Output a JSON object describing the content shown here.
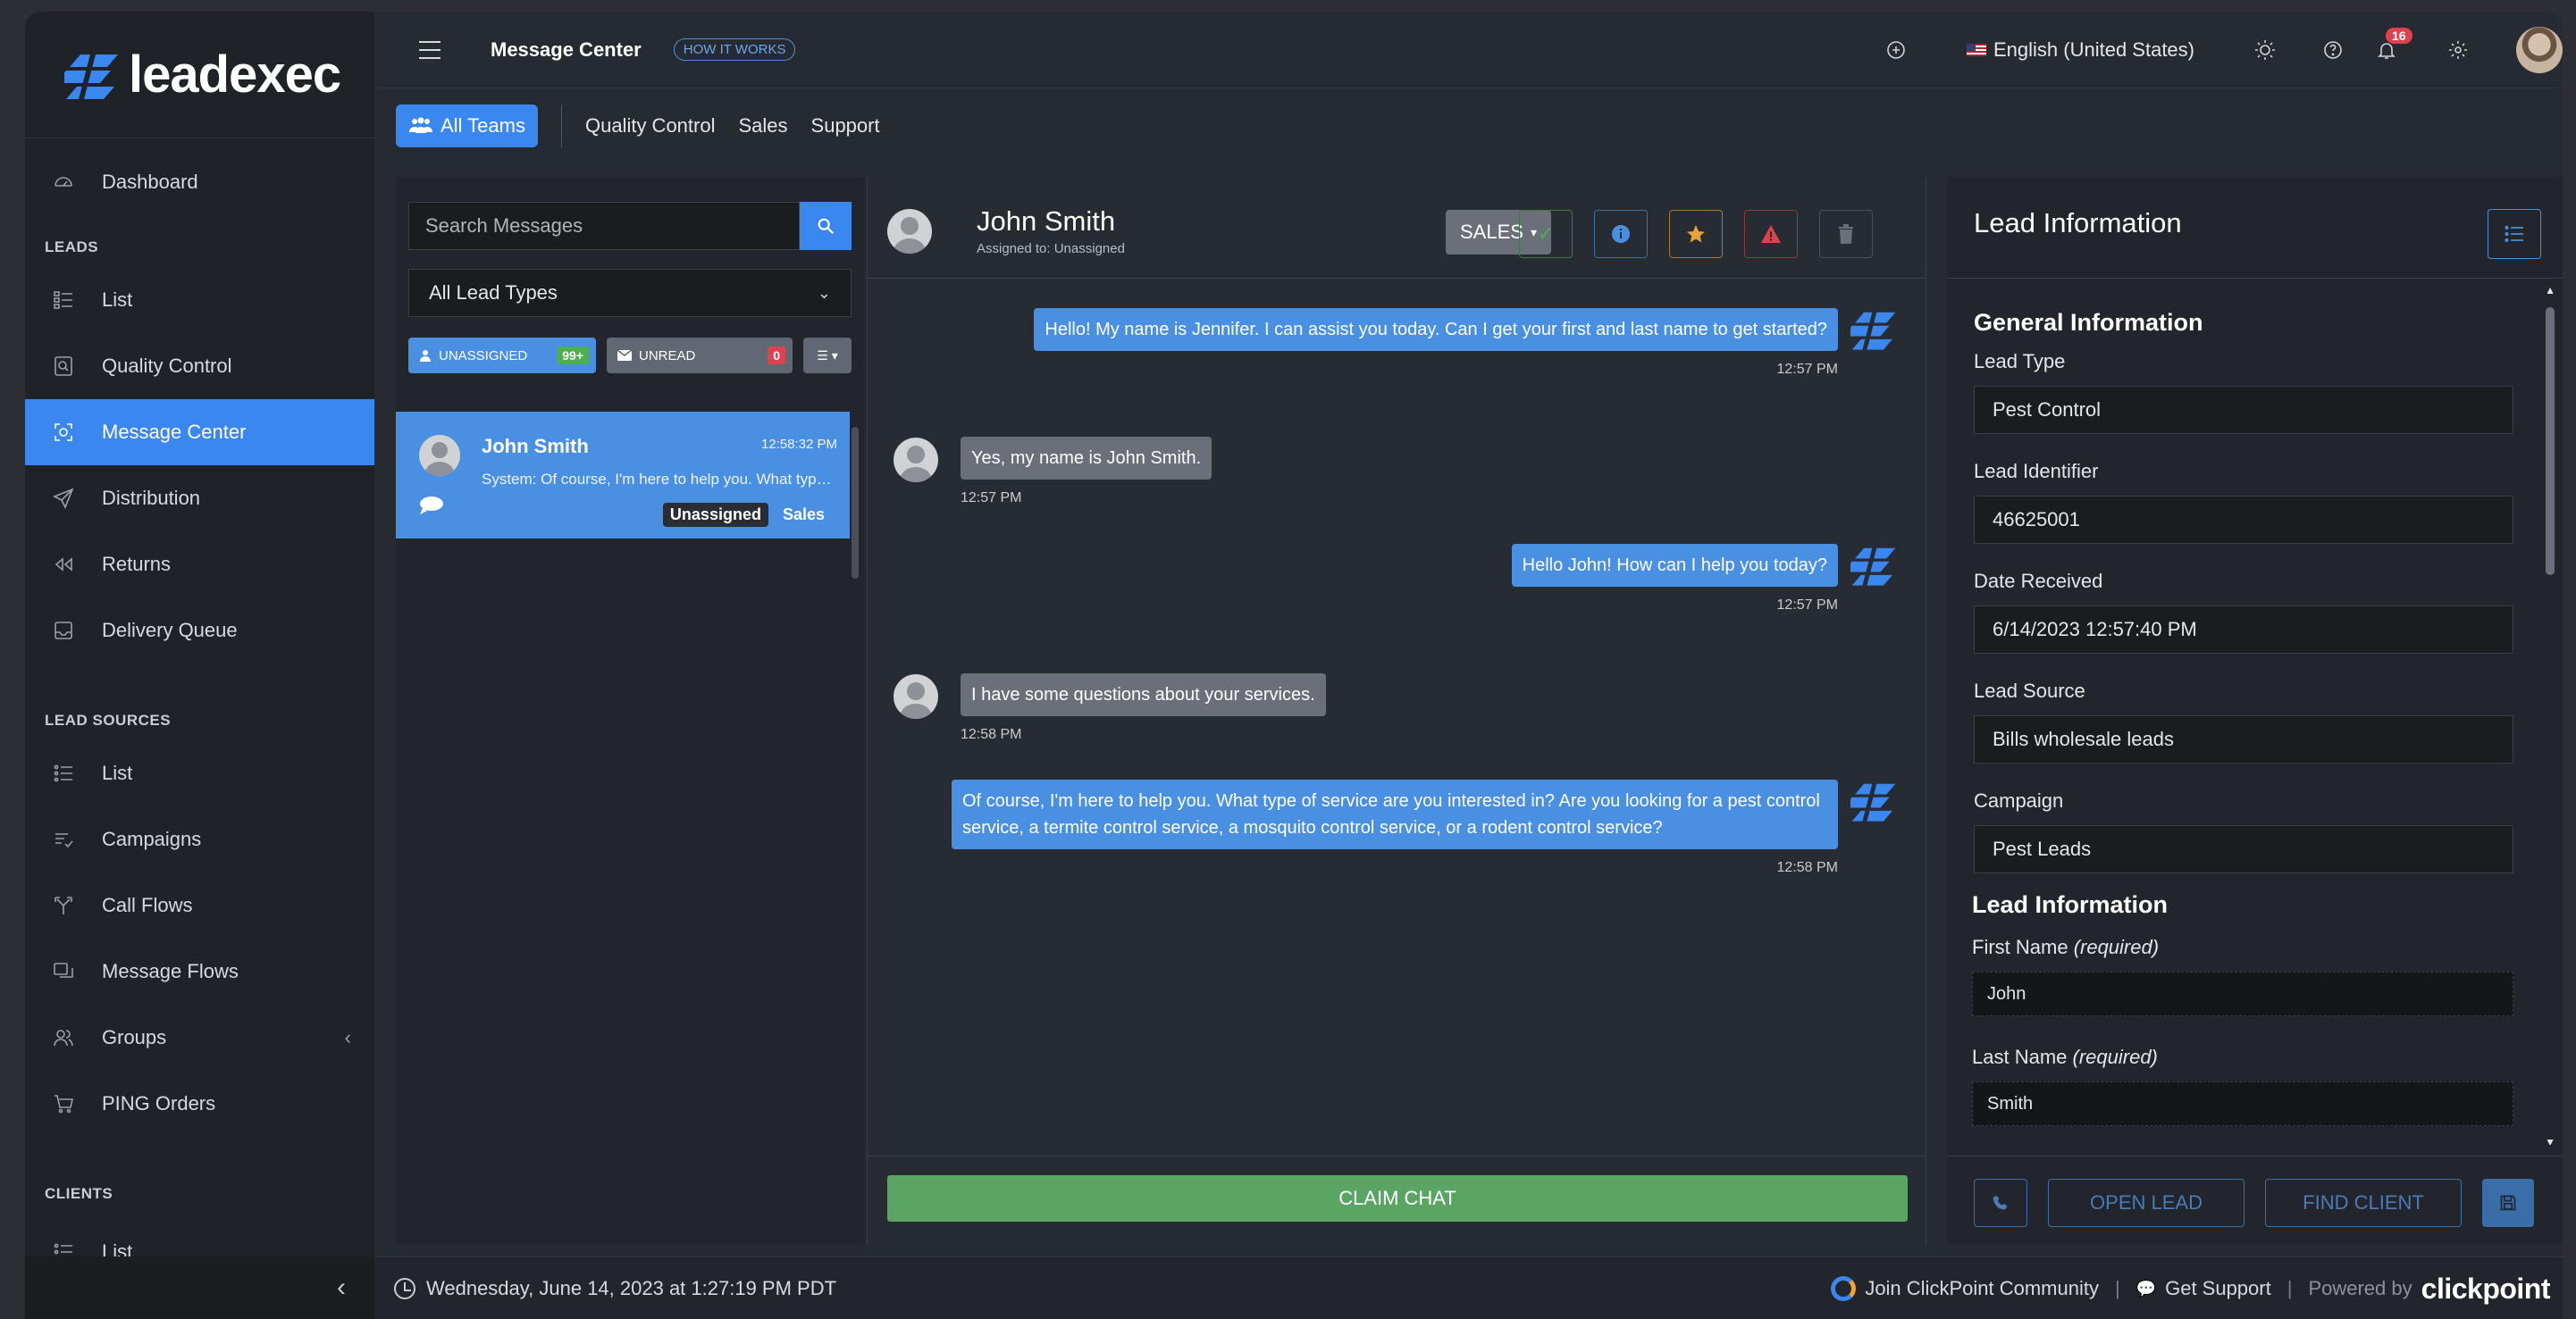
{
  "brand": {
    "name": "leadexec",
    "accent": "#3b87f0"
  },
  "sidebar": {
    "top_items": [
      {
        "label": "Dashboard",
        "icon": "dashboard-icon"
      }
    ],
    "sections": [
      {
        "title": "LEADS",
        "items": [
          {
            "label": "List",
            "icon": "list-icon"
          },
          {
            "label": "Quality Control",
            "icon": "quality-control-icon"
          },
          {
            "label": "Message Center",
            "icon": "message-center-icon",
            "active": true
          },
          {
            "label": "Distribution",
            "icon": "send-icon"
          },
          {
            "label": "Returns",
            "icon": "rewind-icon"
          },
          {
            "label": "Delivery Queue",
            "icon": "inbox-icon"
          }
        ]
      },
      {
        "title": "LEAD SOURCES",
        "items": [
          {
            "label": "List",
            "icon": "list-icon"
          },
          {
            "label": "Campaigns",
            "icon": "campaigns-icon"
          },
          {
            "label": "Call Flows",
            "icon": "call-flows-icon"
          },
          {
            "label": "Message Flows",
            "icon": "message-flows-icon"
          },
          {
            "label": "Groups",
            "icon": "groups-icon"
          },
          {
            "label": "PING Orders",
            "icon": "cart-icon"
          }
        ]
      },
      {
        "title": "CLIENTS",
        "items": [
          {
            "label": "List",
            "icon": "list-icon"
          }
        ]
      }
    ]
  },
  "topbar": {
    "title": "Message Center",
    "how_it_works": "HOW IT WORKS",
    "language": "English (United States)",
    "notification_count": "16"
  },
  "teams": {
    "all": "All Teams",
    "links": [
      "Quality Control",
      "Sales",
      "Support"
    ]
  },
  "left_panel": {
    "search_placeholder": "Search Messages",
    "lead_type_filter": "All Lead Types",
    "unassigned_label": "UNASSIGNED",
    "unassigned_count": "99+",
    "unread_label": "UNREAD",
    "unread_count": "0",
    "conversation": {
      "name": "John Smith",
      "time": "12:58:32 PM",
      "preview": "System: Of course, I'm here to help you. What type of service are you interested in?",
      "tag_status": "Unassigned",
      "tag_team": "Sales"
    }
  },
  "chat": {
    "name": "John Smith",
    "assigned": "Assigned to: Unassigned",
    "team_button": "SALES",
    "messages": [
      {
        "dir": "out",
        "text": "Hello! My name is Jennifer. I can assist you today. Can I get your first and last name to get started?",
        "time": "12:57 PM"
      },
      {
        "dir": "in",
        "text": "Yes, my name is John Smith.",
        "time": "12:57 PM"
      },
      {
        "dir": "out",
        "text": "Hello John! How can I help you today?",
        "time": "12:57 PM"
      },
      {
        "dir": "in",
        "text": "I have some questions about your services.",
        "time": "12:58 PM"
      },
      {
        "dir": "out",
        "text": "Of course, I'm here to help you. What type of service are you interested in? Are you looking for a pest control service, a termite control service, a mosquito control service, or a rodent control service?",
        "time": "12:58 PM"
      }
    ],
    "claim_button": "CLAIM CHAT"
  },
  "lead_info": {
    "title": "Lead Information",
    "general_title": "General Information",
    "fields": [
      {
        "label": "Lead Type",
        "value": "Pest Control"
      },
      {
        "label": "Lead Identifier",
        "value": "46625001"
      },
      {
        "label": "Date Received",
        "value": "6/14/2023 12:57:40 PM"
      },
      {
        "label": "Lead Source",
        "value": "Bills wholesale leads"
      },
      {
        "label": "Campaign",
        "value": "Pest Leads"
      }
    ],
    "lead_section_title": "Lead Information",
    "first_name_label": "First Name",
    "first_name_req": "(required)",
    "first_name_value": "John",
    "last_name_label": "Last Name",
    "last_name_req": "(required)",
    "last_name_value": "Smith",
    "open_lead": "OPEN LEAD",
    "find_client": "FIND CLIENT"
  },
  "statusbar": {
    "datetime": "Wednesday, June 14, 2023 at 1:27:19 PM PDT",
    "community": "Join ClickPoint Community",
    "support": "Get Support",
    "powered_by": "Powered by",
    "clickpoint": "clickpoint"
  }
}
